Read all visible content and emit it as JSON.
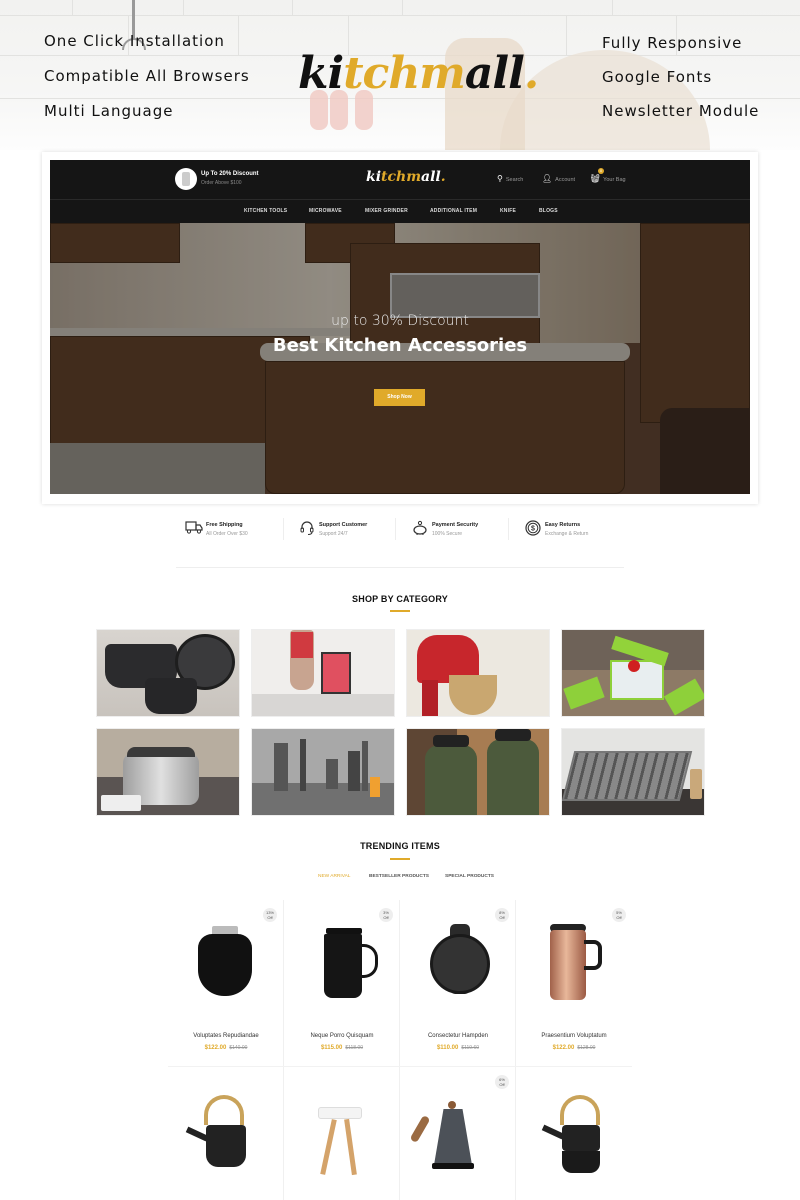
{
  "banner": {
    "features_left": [
      "One Click Installation",
      "Compatible All Browsers",
      "Multi Language"
    ],
    "features_right": [
      "Fully Responsive",
      "Google Fonts",
      "Newsletter Module"
    ],
    "logo": {
      "part1": "ki",
      "part2": "tchm",
      "part3": "all",
      "dot": "."
    }
  },
  "header": {
    "promo_title": "Up To 20% Discount",
    "promo_sub": "Order Above $100",
    "logo": {
      "part1": "ki",
      "part2": "tchm",
      "part3": "all",
      "dot": "."
    },
    "search_label": "Search",
    "account_label": "Account",
    "bag_label": "Your Bag",
    "bag_count": "0",
    "nav": [
      "KITCHEN TOOLS",
      "MICROWAVE",
      "MIXER GRINDER",
      "ADDITIONAL ITEM",
      "KNIFE",
      "BLOGS"
    ]
  },
  "hero": {
    "subtitle": "up to 30% Discount",
    "title": "Best Kitchen Accessories",
    "button": "Shop Now"
  },
  "services": [
    {
      "icon": "truck-icon",
      "glyph": "🚚",
      "title": "Free Shipping",
      "sub": "All Order Over $30"
    },
    {
      "icon": "headset-icon",
      "glyph": "🎧",
      "title": "Support Customer",
      "sub": "Support 24/7"
    },
    {
      "icon": "piggy-bank-icon",
      "glyph": "🐖",
      "title": "Payment Security",
      "sub": "100% Secure"
    },
    {
      "icon": "dollar-return-icon",
      "glyph": "$",
      "title": "Easy Returns",
      "sub": "Exchange & Return"
    }
  ],
  "categories": {
    "title": "SHOP BY CATEGORY",
    "items": [
      "cookware-pots",
      "blender",
      "stand-mixer",
      "vegetable-chopper",
      "slow-cooker",
      "hand-blenders",
      "water-bottles",
      "gas-cooktop"
    ]
  },
  "trending": {
    "title": "TRENDING ITEMS",
    "tabs": [
      "NEW ARRIVAL",
      "BESTSELLER PRODUCTS",
      "SPECIAL PRODUCTS"
    ],
    "active_tab": "NEW ARRIVAL",
    "products": [
      {
        "name": "Voluptates Repudiandae",
        "price": "$122.00",
        "old_price": "$140.00",
        "discount": "13%",
        "off": "Off"
      },
      {
        "name": "Neque Porro Quisquam",
        "price": "$115.00",
        "old_price": "$118.00",
        "discount": "3%",
        "off": "Off"
      },
      {
        "name": "Consectetur Hampden",
        "price": "$110.00",
        "old_price": "$119.60",
        "discount": "8%",
        "off": "Off"
      },
      {
        "name": "Praesentium Voluptatum",
        "price": "$122.00",
        "old_price": "$128.00",
        "discount": "5%",
        "off": "Off"
      },
      {
        "name": "",
        "price": "",
        "old_price": "",
        "discount": "",
        "off": ""
      },
      {
        "name": "",
        "price": "",
        "old_price": "",
        "discount": "",
        "off": ""
      },
      {
        "name": "",
        "price": "",
        "old_price": "",
        "discount": "6%",
        "off": "Off"
      },
      {
        "name": "",
        "price": "",
        "old_price": "",
        "discount": "",
        "off": ""
      }
    ]
  },
  "colors": {
    "accent": "#e0aa2a",
    "header_bg": "#151515"
  }
}
